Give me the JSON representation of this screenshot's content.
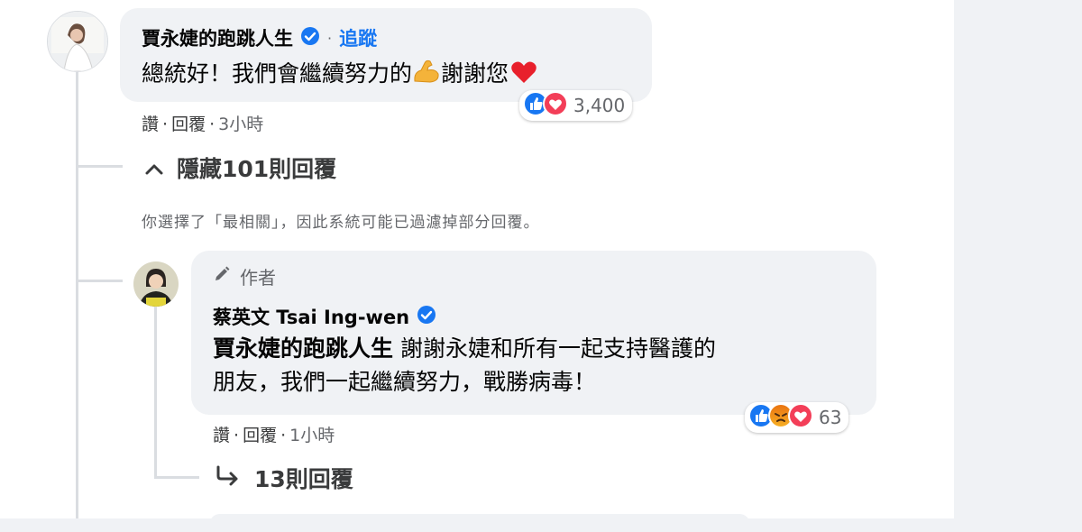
{
  "comment": {
    "author": "賈永婕的跑跳人生",
    "follow_label": "追蹤",
    "text_main": "總統好！我們會繼續努力的",
    "text_end": "謝謝您",
    "reaction_count": "3,400",
    "actions": {
      "like": "讚",
      "reply": "回覆",
      "time": "3小時"
    }
  },
  "replies_toggle": {
    "label": "隱藏101則回覆"
  },
  "filter_notice": "你選擇了「最相關」，因此系統可能已過濾掉部分回覆。",
  "reply": {
    "author_tag": "作者",
    "author": "蔡英文 Tsai Ing-wen",
    "mention": "賈永婕的跑跳人生",
    "text_line1": "謝謝永婕和所有一起支持醫護的",
    "text_line2": "朋友，我們一起繼續努力，戰勝病毒！",
    "reaction_count": "63",
    "actions": {
      "like": "讚",
      "reply": "回覆",
      "time": "1小時"
    }
  },
  "more_replies": {
    "label": "13則回覆"
  },
  "colors": {
    "accent": "#1877f2",
    "bubble": "#f0f2f5",
    "love": "#f33e58",
    "angry": "#e9710f"
  },
  "icons": [
    "verified-badge-icon",
    "like-reaction-icon",
    "love-reaction-icon",
    "angry-reaction-icon",
    "flexed-biceps-emoji",
    "red-heart-emoji",
    "chevron-up-icon",
    "pencil-icon",
    "reply-arrow-icon"
  ]
}
